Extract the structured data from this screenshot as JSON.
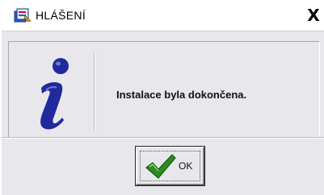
{
  "window": {
    "title": "HLÁŠENÍ",
    "close_label": "X"
  },
  "message": {
    "text": "Instalace byla dokončena.",
    "icon": "information-icon"
  },
  "buttons": {
    "ok_label": "OK",
    "ok_icon": "checkmark-icon"
  },
  "colors": {
    "body_background": "#e8e8ec",
    "info_icon_blue": "#1f2a9c",
    "check_green": "#2e8b1e"
  }
}
